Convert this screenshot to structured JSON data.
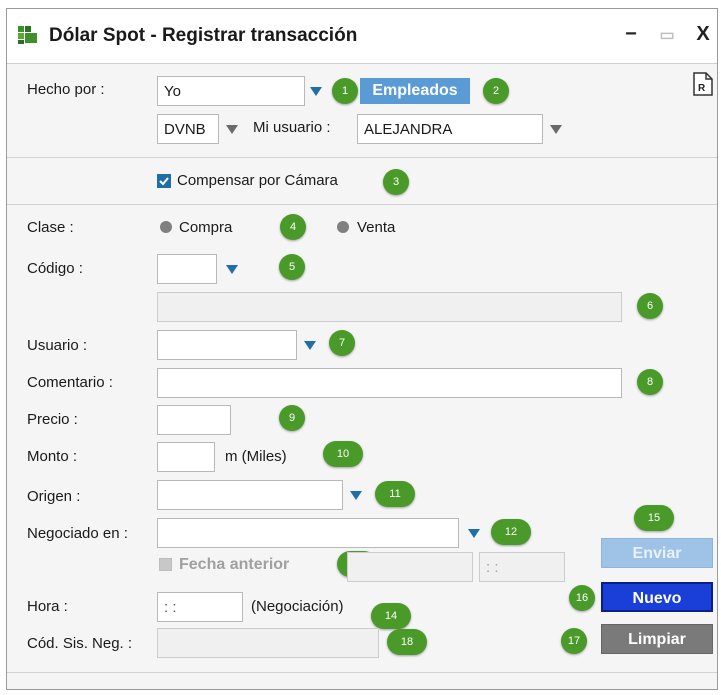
{
  "window": {
    "title": "Dólar Spot - Registrar transacción",
    "icon": "app-logo-icon",
    "controls": {
      "minimize": "−",
      "maximize": "▭",
      "close": "X"
    }
  },
  "report_icon": {
    "label": "R",
    "name": "report-icon"
  },
  "hecho_por": {
    "label": "Hecho por :",
    "value": "Yo",
    "employees_button": "Empleados"
  },
  "dvnb": {
    "value": "DVNB"
  },
  "mi_usuario": {
    "label": "Mi usuario :",
    "value": "ALEJANDRA"
  },
  "compensar": {
    "label": "Compensar por Cámara",
    "checked": true
  },
  "clase": {
    "label": "Clase :",
    "options": [
      "Compra",
      "Venta"
    ]
  },
  "codigo": {
    "label": "Código :",
    "value": ""
  },
  "codigo_desc": {
    "value": ""
  },
  "usuario": {
    "label": "Usuario :",
    "value": ""
  },
  "comentario": {
    "label": "Comentario :",
    "value": ""
  },
  "precio": {
    "label": "Precio :",
    "value": ""
  },
  "monto": {
    "label": "Monto :",
    "value": "",
    "unit": "m (Miles)"
  },
  "origen": {
    "label": "Origen :",
    "value": ""
  },
  "negociado_en": {
    "label": "Negociado en :",
    "value": ""
  },
  "fecha_anterior": {
    "label": "Fecha anterior",
    "date": "",
    "time": ": :"
  },
  "hora": {
    "label": "Hora :",
    "value": ": :",
    "suffix": "(Negociación)"
  },
  "cod_sis_neg": {
    "label": "Cód. Sis. Neg. :",
    "value": ""
  },
  "buttons": {
    "enviar": "Enviar",
    "nuevo": "Nuevo",
    "limpiar": "Limpiar"
  },
  "badges": [
    "1",
    "2",
    "3",
    "4",
    "5",
    "6",
    "7",
    "8",
    "9",
    "10",
    "11",
    "12",
    "13",
    "14",
    "15",
    "16",
    "17",
    "18"
  ],
  "colors": {
    "badge": "#4a9a2a",
    "accent": "#1f6fa6",
    "employees": "#5b9bd5",
    "enviar_disabled": "#9fc3e6",
    "nuevo": "#1a3fd6",
    "limpiar": "#7a7a7a"
  }
}
